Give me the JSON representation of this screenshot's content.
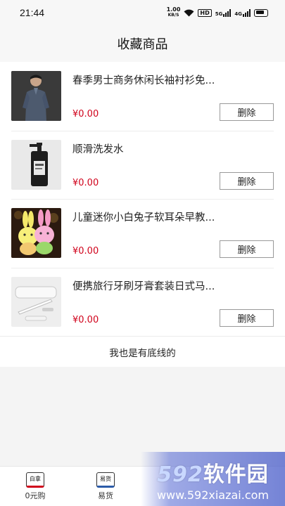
{
  "status": {
    "time": "21:44",
    "speed_top": "1.00",
    "speed_unit": "KB/S",
    "hd": "HD",
    "net1": "5G",
    "net2": "4G"
  },
  "header": {
    "title": "收藏商品"
  },
  "items": [
    {
      "title": "春季男士商务休闲长袖衬衫免...",
      "price": "¥0.00",
      "delete_label": "删除",
      "image": "man-shirt"
    },
    {
      "title": "顺滑洗发水",
      "price": "¥0.00",
      "delete_label": "删除",
      "image": "shampoo-bottle"
    },
    {
      "title": "儿童迷你小白兔子软耳朵早教...",
      "price": "¥0.00",
      "delete_label": "删除",
      "image": "bunny-lamp"
    },
    {
      "title": "便携旅行牙刷牙膏套装日式马...",
      "price": "¥0.00",
      "delete_label": "删除",
      "image": "toothbrush-set"
    }
  ],
  "end_text": "我也是有底线的",
  "tabs": [
    {
      "icon_text": "白拿",
      "label": "0元购",
      "accent": "#d0021b"
    },
    {
      "icon_text": "易货",
      "label": "易货",
      "accent": "#2b5ba8"
    }
  ],
  "watermark": {
    "brand_num": "592",
    "brand_text": "软件园",
    "url": "www.592xiazai.com"
  },
  "colors": {
    "price": "#d0021b",
    "background": "#f4f4f4"
  }
}
